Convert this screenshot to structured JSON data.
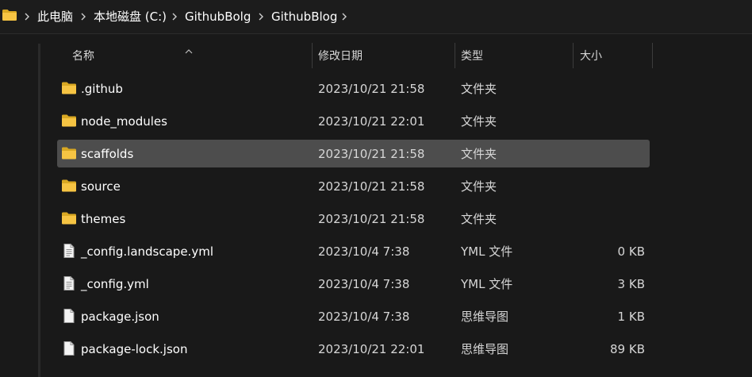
{
  "breadcrumb": {
    "items": [
      "此电脑",
      "本地磁盘 (C:)",
      "GithubBolg",
      "GithubBlog"
    ]
  },
  "columns": {
    "name": "名称",
    "modified": "修改日期",
    "type": "类型",
    "size": "大小",
    "sort": "name-ascending"
  },
  "files": [
    {
      "name": ".github",
      "modified": "2023/10/21 21:58",
      "type": "文件夹",
      "size": "",
      "icon": "folder-icon",
      "selected": false
    },
    {
      "name": "node_modules",
      "modified": "2023/10/21 22:01",
      "type": "文件夹",
      "size": "",
      "icon": "folder-icon",
      "selected": false
    },
    {
      "name": "scaffolds",
      "modified": "2023/10/21 21:58",
      "type": "文件夹",
      "size": "",
      "icon": "folder-icon",
      "selected": true
    },
    {
      "name": "source",
      "modified": "2023/10/21 21:58",
      "type": "文件夹",
      "size": "",
      "icon": "folder-icon",
      "selected": false
    },
    {
      "name": "themes",
      "modified": "2023/10/21 21:58",
      "type": "文件夹",
      "size": "",
      "icon": "folder-icon",
      "selected": false
    },
    {
      "name": "_config.landscape.yml",
      "modified": "2023/10/4 7:38",
      "type": "YML 文件",
      "size": "0 KB",
      "icon": "text-file-icon",
      "selected": false
    },
    {
      "name": "_config.yml",
      "modified": "2023/10/4 7:38",
      "type": "YML 文件",
      "size": "3 KB",
      "icon": "text-file-icon",
      "selected": false
    },
    {
      "name": "package.json",
      "modified": "2023/10/4 7:38",
      "type": "思维导图",
      "size": "1 KB",
      "icon": "blank-file-icon",
      "selected": false
    },
    {
      "name": "package-lock.json",
      "modified": "2023/10/21 22:01",
      "type": "思维导图",
      "size": "89 KB",
      "icon": "blank-file-icon",
      "selected": false
    }
  ],
  "colors": {
    "background": "#191919",
    "selected_row": "#4d4d4d",
    "folder": "#f6c443",
    "text_primary": "#ffffff",
    "text_secondary": "#d6d6d6"
  }
}
